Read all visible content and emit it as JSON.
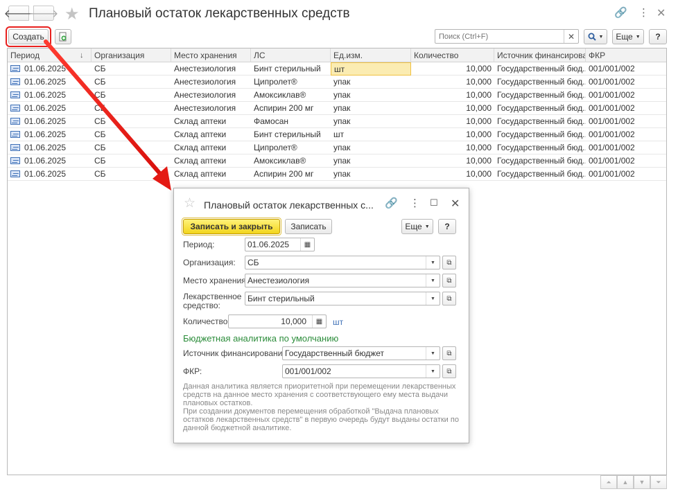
{
  "window": {
    "title": "Плановый остаток лекарственных средств"
  },
  "toolbar": {
    "create_label": "Создать",
    "search_placeholder": "Поиск (Ctrl+F)",
    "more_label": "Еще",
    "help_label": "?"
  },
  "table": {
    "columns": [
      "Период",
      "Организация",
      "Место хранения",
      "ЛС",
      "Ед.изм.",
      "Количество",
      "Источник финансирова...",
      "ФКР"
    ],
    "rows": [
      {
        "period": "01.06.2025",
        "org": "СБ",
        "place": "Анестезиология",
        "drug": "Бинт стерильный",
        "unit": "шт",
        "qty": "10,000",
        "source": "Государственный бюд...",
        "fkr": "001/001/002"
      },
      {
        "period": "01.06.2025",
        "org": "СБ",
        "place": "Анестезиология",
        "drug": "Ципролет®",
        "unit": "упак",
        "qty": "10,000",
        "source": "Государственный бюд...",
        "fkr": "001/001/002"
      },
      {
        "period": "01.06.2025",
        "org": "СБ",
        "place": "Анестезиология",
        "drug": "Амоксиклав®",
        "unit": "упак",
        "qty": "10,000",
        "source": "Государственный бюд...",
        "fkr": "001/001/002"
      },
      {
        "period": "01.06.2025",
        "org": "СБ",
        "place": "Анестезиология",
        "drug": "Аспирин 200 мг",
        "unit": "упак",
        "qty": "10,000",
        "source": "Государственный бюд...",
        "fkr": "001/001/002"
      },
      {
        "period": "01.06.2025",
        "org": "СБ",
        "place": "Склад аптеки",
        "drug": "Фамосан",
        "unit": "упак",
        "qty": "10,000",
        "source": "Государственный бюд...",
        "fkr": "001/001/002"
      },
      {
        "period": "01.06.2025",
        "org": "СБ",
        "place": "Склад аптеки",
        "drug": "Бинт стерильный",
        "unit": "шт",
        "qty": "10,000",
        "source": "Государственный бюд...",
        "fkr": "001/001/002"
      },
      {
        "period": "01.06.2025",
        "org": "СБ",
        "place": "Склад аптеки",
        "drug": "Ципролет®",
        "unit": "упак",
        "qty": "10,000",
        "source": "Государственный бюд...",
        "fkr": "001/001/002"
      },
      {
        "period": "01.06.2025",
        "org": "СБ",
        "place": "Склад аптеки",
        "drug": "Амоксиклав®",
        "unit": "упак",
        "qty": "10,000",
        "source": "Государственный бюд...",
        "fkr": "001/001/002"
      },
      {
        "period": "01.06.2025",
        "org": "СБ",
        "place": "Склад аптеки",
        "drug": "Аспирин 200 мг",
        "unit": "упак",
        "qty": "10,000",
        "source": "Государственный бюд...",
        "fkr": "001/001/002"
      }
    ]
  },
  "dialog": {
    "title": "Плановый остаток лекарственных с...",
    "save_close_label": "Записать и закрыть",
    "save_label": "Записать",
    "more_label": "Еще",
    "help_label": "?",
    "period_label": "Период:",
    "period_value": "01.06.2025",
    "org_label": "Организация:",
    "org_value": "СБ",
    "place_label": "Место хранения:",
    "place_value": "Анестезиология",
    "drug_label_1": "Лекарственное",
    "drug_label_2": "средство:",
    "drug_value": "Бинт стерильный",
    "qty_label": "Количество:",
    "qty_value": "10,000",
    "unit_value": "шт",
    "section_title": "Бюджетная аналитика по умолчанию",
    "source_label": "Источник финансирования:",
    "source_value": "Государственный бюджет",
    "fkr_label": "ФКР:",
    "fkr_value": "001/001/002",
    "note_1": "Данная аналитика является приоритетной при перемещении лекарственных средств на данное место хранения с соответствующего ему места выдачи плановых остатков.",
    "note_2": "При создании документов перемещения обработкой \"Выдача плановых остатков лекарственных средств\" в первую очередь будут выданы остатки по данной бюджетной аналитике."
  },
  "colors": {
    "accent_yellow": "#f2d51c",
    "highlight_red": "#e8201e",
    "section_green": "#2b8c3a",
    "selected_cell": "#fbecb2"
  }
}
